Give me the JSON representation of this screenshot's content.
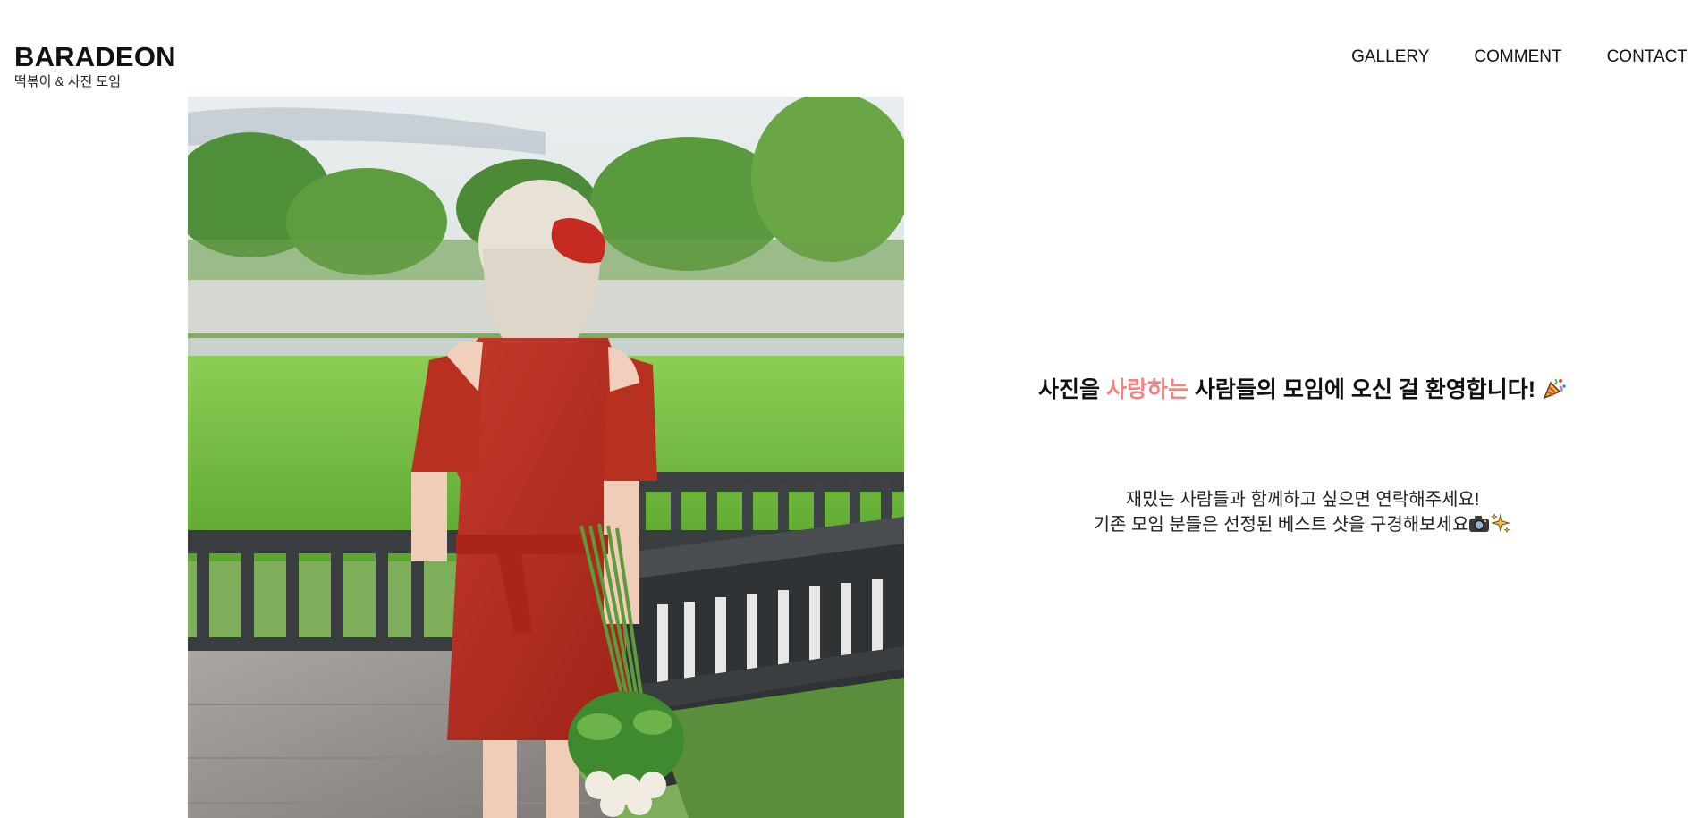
{
  "header": {
    "brand": "BARADEON",
    "tagline": "떡볶이 & 사진 모임",
    "nav": [
      "GALLERY",
      "COMMENT",
      "CONTACT"
    ]
  },
  "hero": {
    "image_icon": "woman-in-red-dress-holding-flowers-photo",
    "welcome_before": "사진을",
    "welcome_accent": "사랑하는",
    "welcome_after": "사람들의 모임에 오신 걸 환영합니다!",
    "welcome_emoji": "party-popper-icon",
    "invite_line1": "재밌는 사람들과 함께하고 싶으면 연락해주세요!",
    "invite_line2": "기존 모임 분들은 선정된 베스트 샷을 구경해보세요",
    "invite_emojis": [
      "camera-icon",
      "sparkles-icon"
    ],
    "accent_color": "#f08383"
  }
}
